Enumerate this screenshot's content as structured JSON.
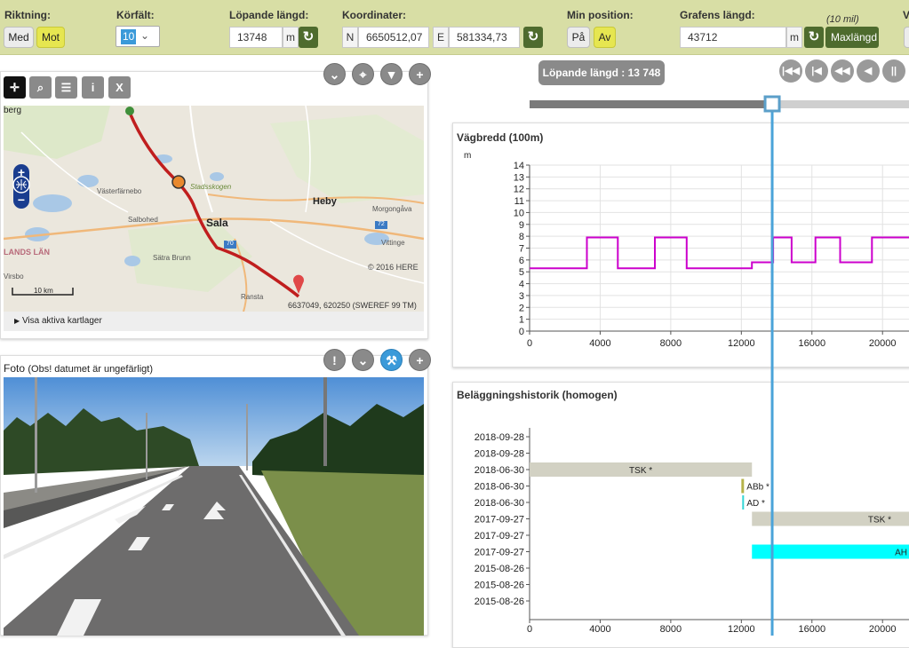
{
  "toolbar": {
    "riktning_label": "Riktning:",
    "med_label": "Med",
    "mot_label": "Mot",
    "korfalt_label": "Körfält:",
    "korfalt_value": "10",
    "lopande_label": "Löpande längd:",
    "lopande_value": "13748",
    "lopande_unit": "m",
    "koordinater_label": "Koordinater:",
    "n_label": "N",
    "n_value": "6650512,07",
    "e_label": "E",
    "e_value": "581334,73",
    "minpos_label": "Min position:",
    "pa_label": "På",
    "av_label": "Av",
    "grafens_label": "Grafens längd:",
    "grafens_value": "43712",
    "grafens_unit": "m",
    "mil_note": "(10 mil)",
    "maxlangd_label": "Maxlängd",
    "cut_label": "V",
    "accent_color": "#e6e650",
    "dark_green": "#4e6b2e"
  },
  "map_panel": {
    "labels": {
      "berg": "berg",
      "vasterfarnebo": "Västerfärnebo",
      "stadsskogen": "Stadsskogen",
      "salbohed": "Salbohed",
      "sala": "Sala",
      "heby": "Heby",
      "morgongava": "Morgongåva",
      "vittinge": "Vittinge",
      "lands_lan": "LANDS LÄN",
      "satra_brunn": "Sätra Brunn",
      "virsbo": "Virsbo",
      "ransta": "Ransta",
      "road_72": "72",
      "road_70": "70"
    },
    "copyright": "© 2016 HERE",
    "scale_label": "10 km",
    "coord_readout": "6637049, 620250 (SWEREF 99 TM)",
    "layers_label": "Visa aktiva kartlager"
  },
  "photo_panel": {
    "title": "Foto",
    "subtitle": "(Obs! datumet är ungefärligt)"
  },
  "timeline": {
    "position_label": "Löpande längd : 13 748",
    "slider_fraction": 0.64
  },
  "chart_data": [
    {
      "type": "line",
      "title": "Vägbredd (100m)",
      "ylabel": "m",
      "xlim": [
        0,
        21500
      ],
      "ylim": [
        0,
        14
      ],
      "yticks": [
        0,
        1,
        2,
        3,
        4,
        5,
        6,
        7,
        8,
        9,
        10,
        11,
        12,
        13,
        14
      ],
      "xticks": [
        0,
        4000,
        8000,
        12000,
        16000,
        20000
      ],
      "x_tick_labels": [
        "0",
        "4000",
        "8000",
        "12000",
        "16000",
        "20000"
      ],
      "series": [
        {
          "color": "#cc00cc",
          "points": [
            [
              0,
              5.3
            ],
            [
              3250,
              5.3
            ],
            [
              3250,
              7.9
            ],
            [
              5000,
              7.9
            ],
            [
              5000,
              5.3
            ],
            [
              7100,
              5.3
            ],
            [
              7100,
              7.9
            ],
            [
              8900,
              7.9
            ],
            [
              8900,
              5.3
            ],
            [
              12600,
              5.3
            ],
            [
              12600,
              5.8
            ],
            [
              13800,
              5.8
            ],
            [
              13800,
              7.9
            ],
            [
              14850,
              7.9
            ],
            [
              14850,
              5.8
            ],
            [
              16200,
              5.8
            ],
            [
              16200,
              7.9
            ],
            [
              17600,
              7.9
            ],
            [
              17600,
              5.8
            ],
            [
              19400,
              5.8
            ],
            [
              19400,
              7.9
            ],
            [
              21500,
              7.9
            ]
          ]
        }
      ],
      "grid": true
    },
    {
      "type": "bar",
      "title": "Beläggningshistorik (homogen)",
      "xlim": [
        0,
        21500
      ],
      "xticks": [
        0,
        4000,
        8000,
        12000,
        16000,
        20000
      ],
      "x_tick_labels": [
        "0",
        "4000",
        "8000",
        "12000",
        "16000",
        "20000"
      ],
      "rows": [
        {
          "date": "2018-09-28"
        },
        {
          "date": "2018-09-28"
        },
        {
          "date": "2018-06-30",
          "bars": [
            {
              "start": 0,
              "end": 12600,
              "label": "TSK *",
              "color": "#d2d1c3"
            }
          ]
        },
        {
          "date": "2018-06-30",
          "bars": [
            {
              "start": 12000,
              "end": 12150,
              "label": "ABb *",
              "color": "#b5b24a"
            }
          ]
        },
        {
          "date": "2018-06-30",
          "bars": [
            {
              "start": 12050,
              "end": 12150,
              "label": "AD *",
              "color": "#33d6d6"
            }
          ]
        },
        {
          "date": "2017-09-27",
          "bars": [
            {
              "start": 12600,
              "end": 21500,
              "label": "TSK *",
              "color": "#d2d1c3"
            }
          ]
        },
        {
          "date": "2017-09-27"
        },
        {
          "date": "2017-09-27",
          "bars": [
            {
              "start": 12600,
              "end": 21500,
              "label": "AH",
              "color": "#00ffff"
            }
          ]
        },
        {
          "date": "2015-08-26"
        },
        {
          "date": "2015-08-26"
        },
        {
          "date": "2015-08-26"
        }
      ]
    }
  ],
  "current_position": 13748,
  "marker_color": "#4aa3d9"
}
